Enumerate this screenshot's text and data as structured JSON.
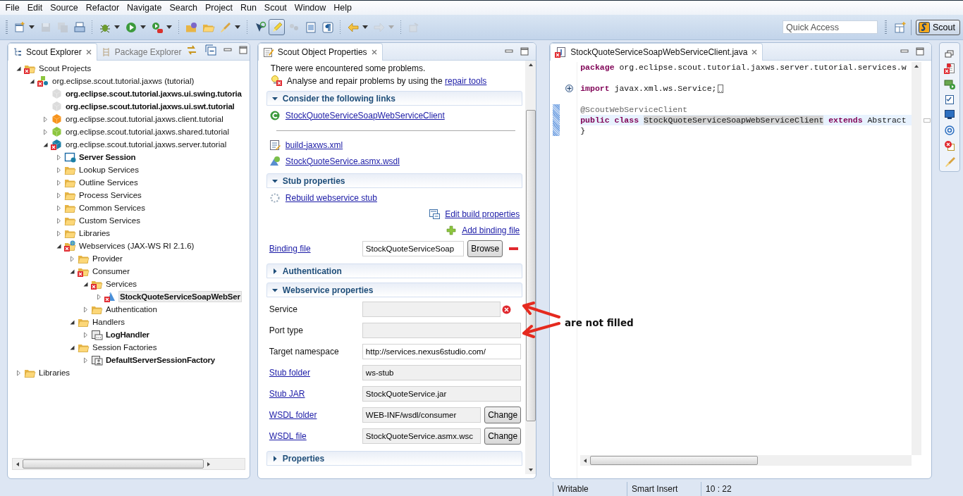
{
  "menu": [
    "File",
    "Edit",
    "Source",
    "Refactor",
    "Navigate",
    "Search",
    "Project",
    "Run",
    "Scout",
    "Window",
    "Help"
  ],
  "toolbar": {
    "items": [
      {
        "kind": "new",
        "dropdown": true,
        "disabled": false,
        "pressed": false
      },
      {
        "kind": "save",
        "dropdown": false,
        "disabled": true,
        "pressed": false
      },
      {
        "kind": "saveall",
        "dropdown": false,
        "disabled": true,
        "pressed": false
      },
      {
        "kind": "print",
        "dropdown": false,
        "disabled": false,
        "pressed": false
      },
      {
        "kind": "separator"
      },
      {
        "kind": "debug",
        "dropdown": true,
        "disabled": false,
        "pressed": false
      },
      {
        "kind": "run",
        "dropdown": true,
        "disabled": false,
        "pressed": false
      },
      {
        "kind": "runext",
        "dropdown": true,
        "disabled": false,
        "pressed": false
      },
      {
        "kind": "separator"
      },
      {
        "kind": "opentype",
        "dropdown": false,
        "disabled": false,
        "pressed": false
      },
      {
        "kind": "openfolder",
        "dropdown": false,
        "disabled": false,
        "pressed": false
      },
      {
        "kind": "brush",
        "dropdown": true,
        "disabled": false,
        "pressed": false
      },
      {
        "kind": "separator"
      },
      {
        "kind": "toggle",
        "dropdown": false,
        "disabled": false,
        "pressed": false
      },
      {
        "kind": "highlight",
        "dropdown": false,
        "disabled": false,
        "pressed": true
      },
      {
        "kind": "occurrences",
        "dropdown": false,
        "disabled": true,
        "pressed": false
      },
      {
        "kind": "block",
        "dropdown": false,
        "disabled": false,
        "pressed": false
      },
      {
        "kind": "pilcrow",
        "dropdown": false,
        "disabled": false,
        "pressed": false
      },
      {
        "kind": "separator"
      },
      {
        "kind": "back",
        "dropdown": true,
        "disabled": false,
        "pressed": false
      },
      {
        "kind": "forward",
        "dropdown": true,
        "disabled": true,
        "pressed": false
      },
      {
        "kind": "separator"
      },
      {
        "kind": "pin",
        "dropdown": false,
        "disabled": true,
        "pressed": false
      }
    ],
    "quick_access": {
      "placeholder": "Quick Access"
    },
    "perspective": {
      "label": "Scout",
      "selected": true
    }
  },
  "explorer": {
    "tabs": [
      {
        "label": "Scout Explorer",
        "selected": true
      },
      {
        "label": "Package Explorer",
        "selected": false
      }
    ],
    "tree": [
      {
        "label": "Scout Projects",
        "kind": "folder",
        "error": true,
        "bold": false,
        "selected": false,
        "expandable": true,
        "expanded": true,
        "children": [
          {
            "label": "org.eclipse.scout.tutorial.jaxws (tutorial)",
            "kind": "project",
            "error": true,
            "bold": false,
            "selected": false,
            "expandable": true,
            "expanded": true,
            "children": [
              {
                "label": "org.eclipse.scout.tutorial.jaxws.ui.swing.tutoria",
                "kind": "bundle",
                "color": "#dcdcdc",
                "error": false,
                "bold": true,
                "selected": false,
                "expandable": false
              },
              {
                "label": "org.eclipse.scout.tutorial.jaxws.ui.swt.tutorial",
                "kind": "bundle",
                "color": "#dcdcdc",
                "error": false,
                "bold": true,
                "selected": false,
                "expandable": false
              },
              {
                "label": "org.eclipse.scout.tutorial.jaxws.client.tutorial",
                "kind": "bundle",
                "color": "#f7941d",
                "error": false,
                "bold": false,
                "selected": false,
                "expandable": true,
                "expanded": false
              },
              {
                "label": "org.eclipse.scout.tutorial.jaxws.shared.tutorial",
                "kind": "bundle",
                "color": "#8dc63f",
                "error": false,
                "bold": false,
                "selected": false,
                "expandable": true,
                "expanded": false
              },
              {
                "label": "org.eclipse.scout.tutorial.jaxws.server.tutorial",
                "kind": "bundle",
                "color": "#1b7fa6",
                "error": true,
                "bold": false,
                "selected": false,
                "expandable": true,
                "expanded": true,
                "children": [
                  {
                    "label": "Server Session",
                    "kind": "session",
                    "error": false,
                    "bold": true,
                    "selected": false,
                    "expandable": true,
                    "expanded": false
                  },
                  {
                    "label": "Lookup Services",
                    "kind": "folder",
                    "error": false,
                    "bold": false,
                    "selected": false,
                    "expandable": true,
                    "expanded": false
                  },
                  {
                    "label": "Outline Services",
                    "kind": "folder",
                    "error": false,
                    "bold": false,
                    "selected": false,
                    "expandable": true,
                    "expanded": false
                  },
                  {
                    "label": "Process Services",
                    "kind": "folder",
                    "error": false,
                    "bold": false,
                    "selected": false,
                    "expandable": true,
                    "expanded": false
                  },
                  {
                    "label": "Common Services",
                    "kind": "folder",
                    "error": false,
                    "bold": false,
                    "selected": false,
                    "expandable": true,
                    "expanded": false
                  },
                  {
                    "label": "Custom Services",
                    "kind": "folder",
                    "error": false,
                    "bold": false,
                    "selected": false,
                    "expandable": true,
                    "expanded": false
                  },
                  {
                    "label": "Libraries",
                    "kind": "folder",
                    "error": false,
                    "bold": false,
                    "selected": false,
                    "expandable": true,
                    "expanded": false
                  },
                  {
                    "label": "Webservices (JAX-WS RI 2.1.6)",
                    "kind": "webservices",
                    "error": true,
                    "bold": false,
                    "selected": false,
                    "expandable": true,
                    "expanded": true,
                    "children": [
                      {
                        "label": "Provider",
                        "kind": "folder",
                        "error": false,
                        "bold": false,
                        "selected": false,
                        "expandable": true,
                        "expanded": false
                      },
                      {
                        "label": "Consumer",
                        "kind": "folder",
                        "error": true,
                        "bold": false,
                        "selected": false,
                        "expandable": true,
                        "expanded": true,
                        "children": [
                          {
                            "label": "Services",
                            "kind": "folder",
                            "error": true,
                            "bold": false,
                            "selected": false,
                            "expandable": true,
                            "expanded": true,
                            "children": [
                              {
                                "label": "StockQuoteServiceSoapWebSer",
                                "kind": "service",
                                "error": true,
                                "bold": true,
                                "selected": true,
                                "expandable": true,
                                "expanded": false
                              }
                            ]
                          },
                          {
                            "label": "Authentication",
                            "kind": "folder",
                            "error": false,
                            "bold": false,
                            "selected": false,
                            "expandable": true,
                            "expanded": false
                          }
                        ]
                      },
                      {
                        "label": "Handlers",
                        "kind": "folder",
                        "error": false,
                        "bold": false,
                        "selected": false,
                        "expandable": true,
                        "expanded": true,
                        "children": [
                          {
                            "label": "LogHandler",
                            "kind": "handler",
                            "error": false,
                            "bold": true,
                            "selected": false,
                            "expandable": true,
                            "expanded": false
                          }
                        ]
                      },
                      {
                        "label": "Session Factories",
                        "kind": "folder",
                        "error": false,
                        "bold": false,
                        "selected": false,
                        "expandable": true,
                        "expanded": true,
                        "children": [
                          {
                            "label": "DefaultServerSessionFactory",
                            "kind": "factory",
                            "error": false,
                            "bold": true,
                            "selected": false,
                            "expandable": true,
                            "expanded": false
                          }
                        ]
                      }
                    ]
                  }
                ]
              }
            ]
          }
        ]
      },
      {
        "label": "Libraries",
        "kind": "folder",
        "error": false,
        "bold": false,
        "selected": false,
        "expandable": true,
        "expanded": false
      }
    ]
  },
  "properties": {
    "tabs": [
      {
        "label": "Scout Object Properties",
        "selected": true
      }
    ],
    "problem": "There were encountered some problems.",
    "repair": {
      "text": "Analyse and repair problems by using the",
      "link": "repair tools"
    },
    "sections": [
      {
        "title": "Consider the following links",
        "expanded": true,
        "items": [
          {
            "kind": "class_link",
            "text": "StockQuoteServiceSoapWebServiceClient"
          },
          {
            "kind": "separator"
          },
          {
            "kind": "xml_link",
            "text": "build-jaxws.xml"
          },
          {
            "kind": "wsdl_link",
            "text": "StockQuoteService.asmx.wsdl"
          }
        ]
      },
      {
        "title": "Stub properties",
        "expanded": true,
        "items": [
          {
            "kind": "rebuild_link",
            "text": "Rebuild webservice stub"
          },
          {
            "kind": "edit_link",
            "text": "Edit build properties"
          },
          {
            "kind": "add_link",
            "text": "Add binding file"
          },
          {
            "kind": "field",
            "label": "Binding file",
            "label_link": true,
            "value": "StockQuoteServiceSoap",
            "editable": true,
            "error": false,
            "button": "Browse",
            "removable": true
          }
        ]
      },
      {
        "title": "Authentication",
        "expanded": false
      },
      {
        "title": "Webservice properties",
        "expanded": true,
        "items": [
          {
            "kind": "field",
            "label": "Service",
            "label_link": false,
            "editable": false,
            "error": true,
            "removable": false
          },
          {
            "kind": "field",
            "label": "Port type",
            "label_link": false,
            "editable": false,
            "error": false,
            "removable": false
          },
          {
            "kind": "field",
            "label": "Target namespace",
            "label_link": false,
            "value": "http://services.nexus6studio.com/",
            "editable": true,
            "error": false,
            "removable": false
          },
          {
            "kind": "field",
            "label": "Stub folder",
            "label_link": true,
            "value": "ws-stub",
            "editable": false,
            "error": false,
            "removable": false
          },
          {
            "kind": "field",
            "label": "Stub JAR",
            "label_link": true,
            "value": "StockQuoteService.jar",
            "editable": false,
            "error": false,
            "removable": false
          },
          {
            "kind": "field",
            "label": "WSDL folder",
            "label_link": true,
            "value": "WEB-INF/wsdl/consumer",
            "editable": false,
            "error": false,
            "button": "Change",
            "removable": false
          },
          {
            "kind": "field",
            "label": "WSDL file",
            "label_link": true,
            "value": "StockQuoteService.asmx.wsc",
            "editable": false,
            "error": false,
            "button": "Change",
            "removable": false
          }
        ]
      },
      {
        "title": "Properties",
        "expanded": false
      }
    ]
  },
  "annotation": {
    "text": "are not filled"
  },
  "editor": {
    "tabs": [
      {
        "label": "StockQuoteServiceSoapWebServiceClient.java",
        "selected": true,
        "error": true
      }
    ],
    "lines": [
      {
        "fold": false,
        "current": false,
        "changed": false,
        "tokens": [
          {
            "text": "package",
            "kind": "keyword"
          },
          {
            "text": "org.eclipse.scout.tutorial.jaxws.server.tutorial.services.w",
            "kind": "plain"
          }
        ]
      },
      {
        "fold": false,
        "current": false,
        "changed": false
      },
      {
        "fold": true,
        "current": false,
        "changed": false,
        "tokens": [
          {
            "text": "import",
            "kind": "keyword"
          },
          {
            "text": "javax.xml.ws.Service;",
            "kind": "plain"
          }
        ]
      },
      {
        "fold": false,
        "current": false,
        "changed": false
      },
      {
        "fold": false,
        "current": false,
        "changed": true,
        "tokens": [
          {
            "text": "@ScoutWebServiceClient",
            "kind": "annotation"
          }
        ]
      },
      {
        "fold": false,
        "current": true,
        "changed": true,
        "tokens": [
          {
            "text": "public",
            "kind": "keyword"
          },
          {
            "text": "class",
            "kind": "keyword"
          },
          {
            "text": "StockQuoteServiceSoapWebServiceClient",
            "kind": "occurrence"
          },
          {
            "text": "extends",
            "kind": "keyword"
          },
          {
            "text": "Abstract",
            "kind": "plain"
          }
        ]
      },
      {
        "fold": false,
        "current": false,
        "changed": true,
        "tokens": [
          {
            "text": "}",
            "kind": "plain"
          }
        ]
      }
    ]
  },
  "status_bar": [
    "Writable",
    "Smart Insert",
    "10 : 22"
  ]
}
